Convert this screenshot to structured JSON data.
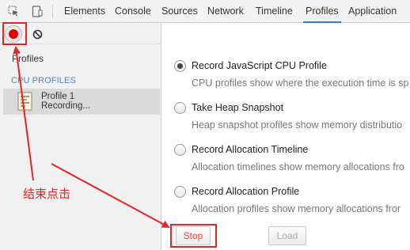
{
  "toolbar": {
    "tabs": [
      "Elements",
      "Console",
      "Sources",
      "Network",
      "Timeline",
      "Profiles",
      "Application"
    ],
    "active_tab": "Profiles",
    "accent_color": "#3879d9"
  },
  "sidebar": {
    "profiles_label": "Profiles",
    "section_header": "CPU PROFILES",
    "profile_item": {
      "name": "Profile 1",
      "status": "Recording..."
    },
    "record_color": "#e00000"
  },
  "main": {
    "options": [
      {
        "label": "Record JavaScript CPU Profile",
        "description": "CPU profiles show where the execution time is sp",
        "checked": true
      },
      {
        "label": "Take Heap Snapshot",
        "description": "Heap snapshot profiles show memory distributio",
        "checked": false
      },
      {
        "label": "Record Allocation Timeline",
        "description": "Allocation timelines show memory allocations fro",
        "checked": false
      },
      {
        "label": "Record Allocation Profile",
        "description": "Allocation profiles show memory allocations fror",
        "checked": false
      }
    ],
    "stop_label": "Stop",
    "load_label": "Load"
  },
  "annotation": {
    "text": "结束点击",
    "color": "#e02626"
  }
}
